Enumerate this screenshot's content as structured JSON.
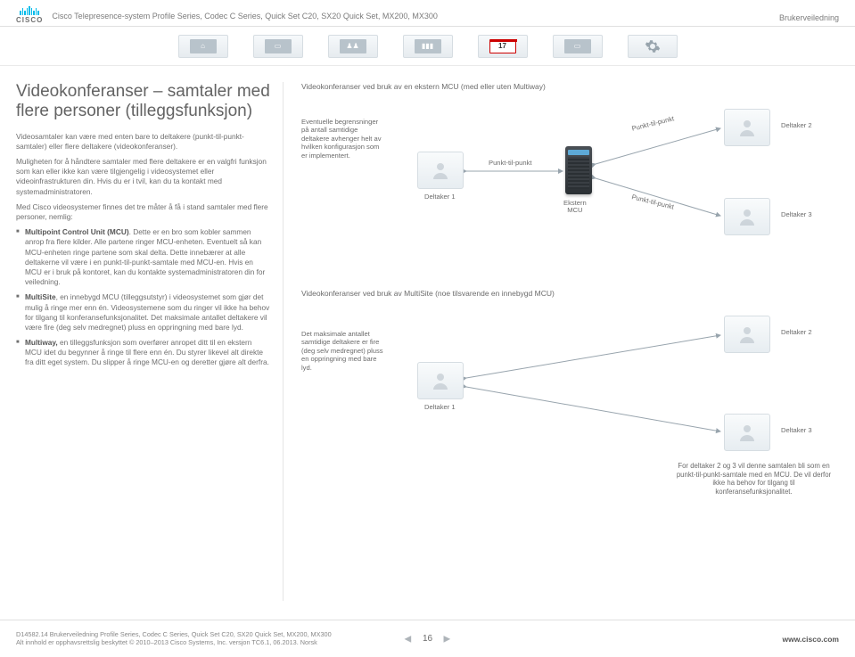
{
  "header": {
    "brand": "CISCO",
    "title": "Cisco Telepresence-system Profile Series, Codec C Series, Quick Set C20, SX20 Quick Set, MX200, MX300",
    "guide": "Brukerveiledning"
  },
  "nav": {
    "icons": [
      "home",
      "screen",
      "people",
      "chart",
      "calendar",
      "book",
      "settings"
    ],
    "calendar_day": "17"
  },
  "left": {
    "title": "Videokonferanser – samtaler med flere personer (tilleggsfunksjon)",
    "p1": "Videosamtaler kan være med enten bare to deltakere (punkt-til-punkt-samtaler) eller flere deltakere (videokonferanser).",
    "p2": "Muligheten for å håndtere samtaler med flere deltakere er en valgfri funksjon som kan eller ikke kan være tilgjengelig i videosystemet eller videoinfrastrukturen din. Hvis du er i tvil, kan du ta kontakt med systemadministratoren.",
    "p3": "Med Cisco videosystemer finnes det tre måter å få i stand samtaler med flere personer, nemlig:",
    "bullets": [
      {
        "strong": "Multipoint Control Unit (MCU)",
        "text": ". Dette er en bro som kobler sammen anrop fra flere kilder. Alle partene ringer MCU-enheten. Eventuelt så kan MCU-enheten ringe partene som skal delta. Dette innebærer at alle deltakerne vil være i en punkt-til-punkt-samtale med MCU-en. Hvis en MCU er i bruk på kontoret, kan du kontakte systemadministratoren din for veiledning."
      },
      {
        "strong": "MultiSite",
        "text": ", en innebygd MCU (tilleggsutstyr) i videosystemet som gjør det mulig å ringe mer enn én. Videosystemene som du ringer vil ikke ha behov for tilgang til konferansefunksjonalitet. Det maksimale antallet deltakere vil være fire (deg selv medregnet) pluss en oppringning med bare lyd."
      },
      {
        "strong": "Multiway,",
        "text": " en tilleggsfunksjon som overfører anropet ditt til en ekstern MCU idet du begynner å ringe til flere enn én. Du styrer likevel alt direkte fra ditt eget system. Du slipper å ringe MCU-en og deretter gjøre alt derfra."
      }
    ]
  },
  "right": {
    "top_head": "Videokonferanser ved bruk av en ekstern MCU (med eller uten Multiway)",
    "top_side": "Eventuelle begrensninger på antall samtidige deltakere avhenger helt av hvilken konfigurasjon som er implementert.",
    "labels": {
      "d1": "Deltaker 1",
      "d2": "Deltaker 2",
      "d3": "Deltaker 3",
      "server": "Ekstern\nMCU",
      "ptp": "Punkt-til-punkt",
      "ptp2": "Punkt-til-punkt",
      "ptp3": "Punkt-til-punkt"
    },
    "bot_head": "Videokonferanser ved bruk av MultiSite (noe tilsvarende en innebygd MCU)",
    "bot_side": "Det maksimale antallet samtidige deltakere er fire (deg selv medregnet) pluss en oppringning med bare lyd.",
    "bot_note": "For deltaker 2 og 3 vil denne samtalen bli som en punkt-til-punkt-samtale med en MCU. De vil derfor ikke ha behov for tilgang til konferansefunksjonalitet."
  },
  "footer": {
    "line": "D14582.14 Brukerveiledning Profile Series, Codec C Series, Quick Set C20, SX20 Quick Set, MX200, MX300\nAlt innhold er opphavsrettslig beskyttet © 2010–2013 Cisco Systems, Inc. versjon TC6.1, 06.2013. Norsk",
    "page": "16",
    "site": "www.cisco.com"
  }
}
